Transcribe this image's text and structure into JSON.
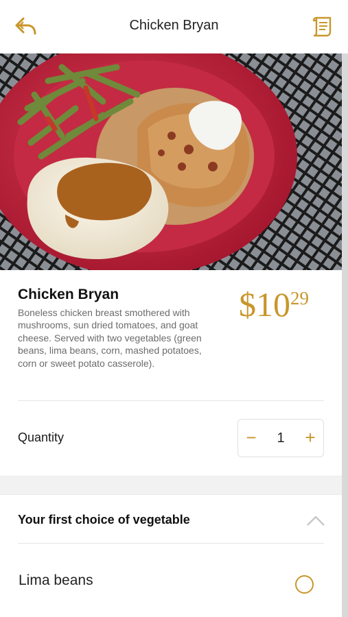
{
  "header": {
    "title": "Chicken Bryan",
    "back_icon": "back-arrow-icon",
    "receipt_icon": "receipt-icon"
  },
  "item": {
    "name": "Chicken Bryan",
    "description": " Boneless chicken breast smothered with mushrooms, sun dried tomatoes, and goat cheese. Served with two vegetables (green beans, lima beans, corn, mashed potatoes, corn or sweet potato casserole).",
    "price_dollars": "$10",
    "price_cents": "29"
  },
  "quantity": {
    "label": "Quantity",
    "minus": "−",
    "value": "1",
    "plus": "+"
  },
  "section": {
    "title": "Your first choice of vegetable",
    "collapse_icon": "chevron-up-icon"
  },
  "options": [
    {
      "label": "Lima beans",
      "selected": false
    }
  ],
  "colors": {
    "accent": "#c9962b",
    "plate": "#c8243e"
  }
}
